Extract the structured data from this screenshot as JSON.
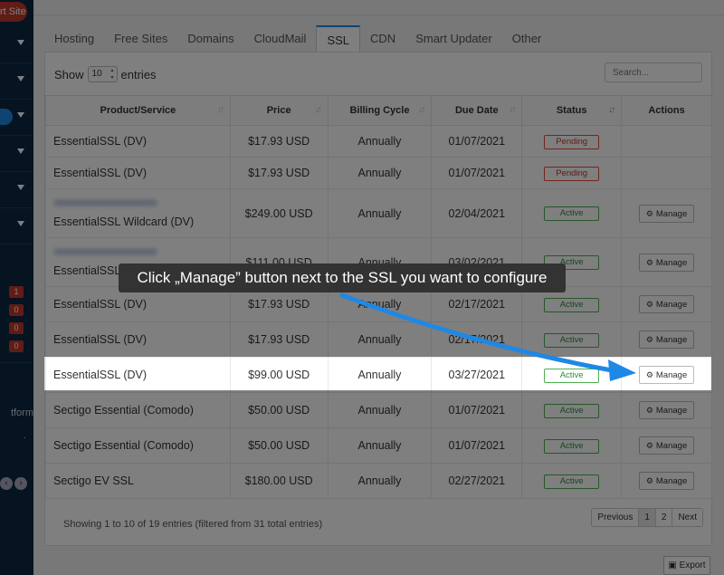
{
  "sidebar": {
    "top_button": "rt Site",
    "badges": [
      "1",
      "0",
      "0",
      "0"
    ],
    "platform_text": "tform",
    "accent": "#1e88e5"
  },
  "tabs": [
    {
      "label": "Hosting",
      "active": false
    },
    {
      "label": "Free Sites",
      "active": false
    },
    {
      "label": "Domains",
      "active": false
    },
    {
      "label": "CloudMail",
      "active": false
    },
    {
      "label": "SSL",
      "active": true
    },
    {
      "label": "CDN",
      "active": false
    },
    {
      "label": "Smart Updater",
      "active": false
    },
    {
      "label": "Other",
      "active": false
    }
  ],
  "controls": {
    "show_label": "Show",
    "entries_value": "10",
    "entries_label": "entries",
    "search_placeholder": "Search..."
  },
  "table": {
    "columns": [
      "Product/Service",
      "Price",
      "Billing Cycle",
      "Due Date",
      "Status",
      "Actions"
    ],
    "rows": [
      {
        "product": "EssentialSSL (DV)",
        "price": "$17.93 USD",
        "cycle": "Annually",
        "due": "01/07/2021",
        "status": "Pending",
        "action": ""
      },
      {
        "product": "EssentialSSL (DV)",
        "price": "$17.93 USD",
        "cycle": "Annually",
        "due": "01/07/2021",
        "status": "Pending",
        "action": ""
      },
      {
        "product": "EssentialSSL Wildcard (DV)",
        "price": "$249.00 USD",
        "cycle": "Annually",
        "due": "02/04/2021",
        "status": "Active",
        "action": "Manage"
      },
      {
        "product": "EssentialSSL Wildcard (DV)",
        "price": "$111.00 USD",
        "cycle": "Annually",
        "due": "03/02/2021",
        "status": "Active",
        "action": "Manage"
      },
      {
        "product": "EssentialSSL (DV)",
        "price": "$17.93 USD",
        "cycle": "Annually",
        "due": "02/17/2021",
        "status": "Active",
        "action": "Manage"
      },
      {
        "product": "EssentialSSL (DV)",
        "price": "$17.93 USD",
        "cycle": "Annually",
        "due": "02/17/2021",
        "status": "Active",
        "action": "Manage"
      },
      {
        "product": "EssentialSSL (DV)",
        "price": "$99.00 USD",
        "cycle": "Annually",
        "due": "03/27/2021",
        "status": "Active",
        "action": "Manage"
      },
      {
        "product": "Sectigo Essential (Comodo)",
        "price": "$50.00 USD",
        "cycle": "Annually",
        "due": "01/07/2021",
        "status": "Active",
        "action": "Manage"
      },
      {
        "product": "Sectigo Essential (Comodo)",
        "price": "$50.00 USD",
        "cycle": "Annually",
        "due": "01/07/2021",
        "status": "Active",
        "action": "Manage"
      },
      {
        "product": "Sectigo EV SSL",
        "price": "$180.00 USD",
        "cycle": "Annually",
        "due": "02/27/2021",
        "status": "Active",
        "action": "Manage"
      }
    ]
  },
  "footer": {
    "info": "Showing 1 to 10 of 19 entries (filtered from 31 total entries)",
    "pager": {
      "previous": "Previous",
      "pages": [
        "1",
        "2"
      ],
      "next": "Next"
    },
    "export": "Export"
  },
  "callout": {
    "text": "Click „Manage” button next to the SSL you want to configure"
  },
  "colors": {
    "pending": "#e74c3c",
    "active": "#4caf50",
    "arrow": "#1e88e5"
  }
}
